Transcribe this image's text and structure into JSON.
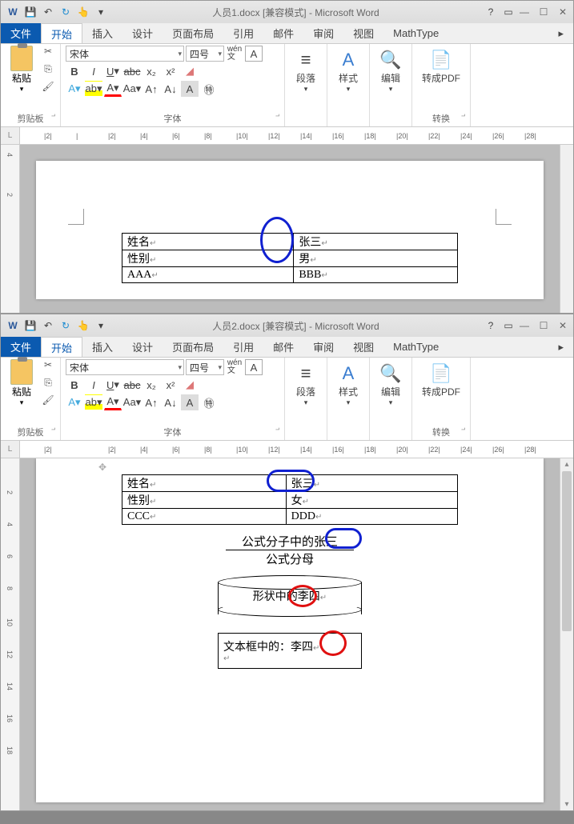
{
  "window1": {
    "title": "人员1.docx [兼容模式] - Microsoft Word",
    "tabs": {
      "file": "文件",
      "home": "开始",
      "insert": "插入",
      "design": "设计",
      "layout": "页面布局",
      "ref": "引用",
      "mail": "邮件",
      "review": "审阅",
      "view": "视图",
      "mathtype": "MathType"
    },
    "clipboard": {
      "paste": "粘贴",
      "label": "剪贴板"
    },
    "font": {
      "name": "宋体",
      "size": "四号",
      "label": "字体"
    },
    "paragraph": "段落",
    "styles": "样式",
    "editing": "编辑",
    "pdf": "转成PDF",
    "convert": "转换",
    "ruler": {
      "marks": [
        "1",
        "2",
        "1",
        "1",
        "2",
        "1",
        "4",
        "1",
        "6",
        "1",
        "8",
        "1",
        "10",
        "1",
        "12",
        "1",
        "14",
        "1",
        "16",
        "1",
        "18",
        "1",
        "20",
        "1",
        "22",
        "1",
        "24",
        "1",
        "26",
        "1",
        "28"
      ]
    },
    "vruler": [
      "1",
      "4",
      "1",
      "2",
      "1"
    ],
    "table": [
      [
        "姓名",
        "张三"
      ],
      [
        "性别",
        "男"
      ],
      [
        "AAA",
        "BBB"
      ]
    ]
  },
  "window2": {
    "title": "人员2.docx [兼容模式] - Microsoft Word",
    "tabs": {
      "file": "文件",
      "home": "开始",
      "insert": "插入",
      "design": "设计",
      "layout": "页面布局",
      "ref": "引用",
      "mail": "邮件",
      "review": "审阅",
      "view": "视图",
      "mathtype": "MathType"
    },
    "clipboard": {
      "paste": "粘贴",
      "label": "剪贴板"
    },
    "font": {
      "name": "宋体",
      "size": "四号",
      "label": "字体"
    },
    "paragraph": "段落",
    "styles": "样式",
    "editing": "编辑",
    "pdf": "转成PDF",
    "convert": "转换",
    "vruler": [
      "1",
      "1",
      "2",
      "1",
      "4",
      "1",
      "6",
      "1",
      "8",
      "1",
      "10",
      "1",
      "12",
      "1",
      "14",
      "1",
      "16",
      "1",
      "18"
    ],
    "table": [
      [
        "姓名",
        "张三"
      ],
      [
        "性别",
        "女"
      ],
      [
        "CCC",
        "DDD"
      ]
    ],
    "fraction": {
      "num": "公式分子中的张三",
      "den": "公式分母"
    },
    "shape_text": "形状中的李四",
    "textbox_text": "文本框中的：李四"
  }
}
